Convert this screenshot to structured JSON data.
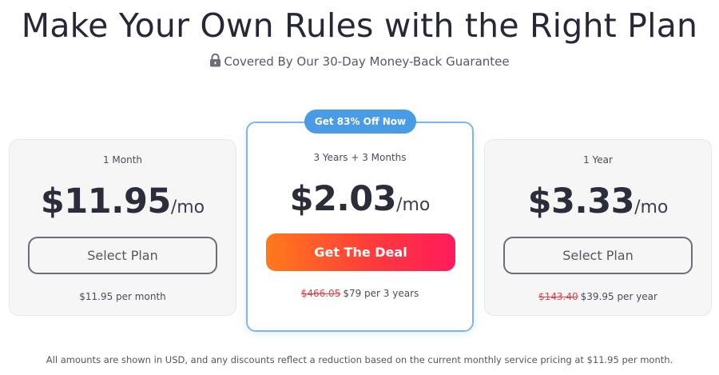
{
  "header": {
    "title": "Make Your Own Rules with the Right Plan",
    "guarantee_icon": "lock-icon",
    "guarantee_text": "Covered By Our 30-Day Money-Back Guarantee"
  },
  "plans": [
    {
      "term": "1 Month",
      "price": "$11.95",
      "unit": "/mo",
      "button_label": "Select Plan",
      "original_price": "",
      "billing_note": "$11.95 per month"
    },
    {
      "badge": "Get 83% Off Now",
      "term": "3 Years + 3 Months",
      "price": "$2.03",
      "unit": "/mo",
      "button_label": "Get The Deal",
      "original_price": "$466.05",
      "billing_note": "$79 per 3 years"
    },
    {
      "term": "1 Year",
      "price": "$3.33",
      "unit": "/mo",
      "button_label": "Select Plan",
      "original_price": "$143.40",
      "billing_note": "$39.95 per year"
    }
  ],
  "footer": {
    "disclaimer": "All amounts are shown in USD, and any discounts reflect a reduction based on the current monthly service pricing at $11.95 per month."
  },
  "colors": {
    "badge": "#4a9be6",
    "featured_border": "#7fb5ec",
    "cta_gradient_start": "#ff7a1a",
    "cta_gradient_end": "#ff1a5a",
    "strikethrough": "#e8404a"
  }
}
